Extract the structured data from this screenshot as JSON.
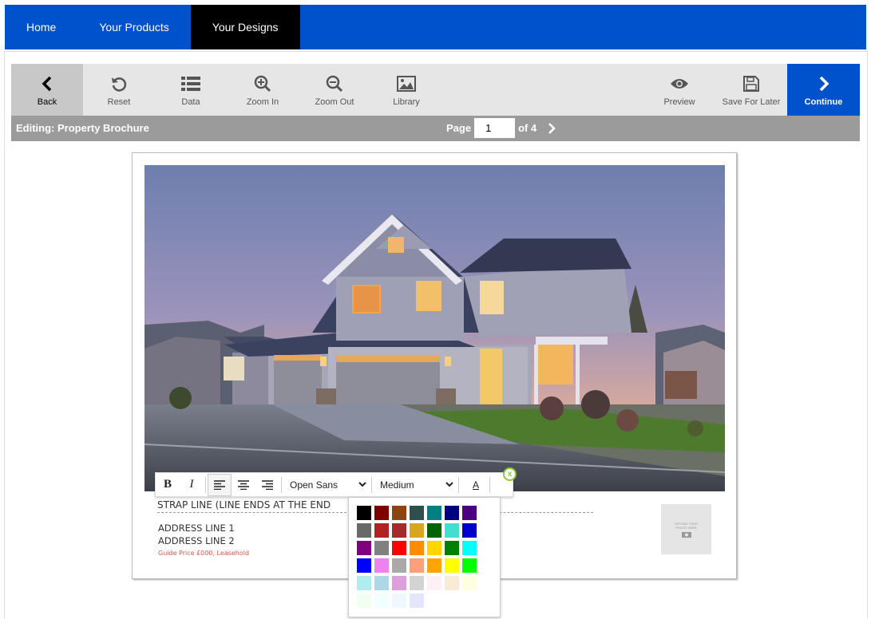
{
  "nav": {
    "items": [
      {
        "label": "Home",
        "active": false
      },
      {
        "label": "Your Products",
        "active": false
      },
      {
        "label": "Your Designs",
        "active": true
      }
    ]
  },
  "toolbar": {
    "back": {
      "label": "Back",
      "icon": "chevron-left-icon"
    },
    "reset": {
      "label": "Reset",
      "icon": "undo-icon"
    },
    "data": {
      "label": "Data",
      "icon": "list-icon"
    },
    "zoom_in": {
      "label": "Zoom In",
      "icon": "zoom-in-icon"
    },
    "zoom_out": {
      "label": "Zoom Out",
      "icon": "zoom-out-icon"
    },
    "library": {
      "label": "Library",
      "icon": "image-icon"
    },
    "preview": {
      "label": "Preview",
      "icon": "eye-icon"
    },
    "save": {
      "label": "Save For Later",
      "icon": "floppy-disk-icon"
    },
    "continue": {
      "label": "Continue",
      "icon": "chevron-right-icon"
    }
  },
  "editing": {
    "label": "Editing: Property Brochure",
    "page_label": "Page",
    "page_value": "1",
    "page_total": "of 4"
  },
  "document": {
    "strap_line": "STRAP LINE (LINE ENDS AT THE END",
    "address_line_1": "ADDRESS LINE 1",
    "address_line_2": "ADDRESS LINE 2",
    "price_line": "Guide Price £000, Leasehold",
    "logo_placeholder_text": "UPLOAD YOUR PHOTO HERE"
  },
  "formatting": {
    "bold": "B",
    "italic": "I",
    "font": "Open Sans",
    "size": "Medium",
    "color_button": "A",
    "close": "x"
  },
  "colors": {
    "accent": "#0052cc",
    "palette": [
      "#000000",
      "#800000",
      "#8b4513",
      "#2f4f4f",
      "#008080",
      "#000080",
      "#4b0082",
      "#696969",
      "#b22222",
      "#a52a2a",
      "#daa520",
      "#006400",
      "#40e0d0",
      "#0000cd",
      "#800080",
      "#808080",
      "#ff0000",
      "#ff8c00",
      "#ffd700",
      "#008000",
      "#00ffff",
      "#0000ff",
      "#ee82ee",
      "#a9a9a9",
      "#ffa07a",
      "#ffa500",
      "#ffff00",
      "#00ff00",
      "#afeeee",
      "#add8e6",
      "#dda0dd",
      "#d3d3d3",
      "#fff0f5",
      "#faebd7",
      "#ffffe0",
      "#f0fff0",
      "#f0ffff",
      "#f0f8ff",
      "#e6e6fa",
      "#ffffff",
      "#ffffff",
      "#ffffff"
    ]
  }
}
